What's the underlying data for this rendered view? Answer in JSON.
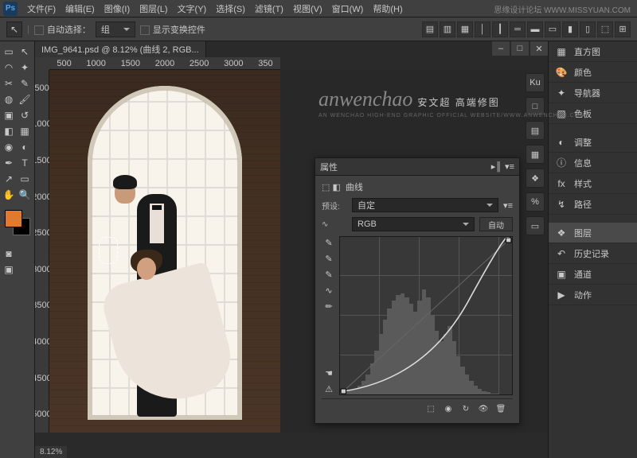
{
  "menubar": {
    "items": [
      "文件(F)",
      "编辑(E)",
      "图像(I)",
      "图层(L)",
      "文字(Y)",
      "选择(S)",
      "滤镜(T)",
      "视图(V)",
      "窗口(W)",
      "帮助(H)"
    ]
  },
  "watermark_top": "思缘设计论坛 WWW.MISSYUAN.COM",
  "options": {
    "auto_select": "自动选择：",
    "group": "组",
    "show_transform": "显示变换控件"
  },
  "document": {
    "tab_title": "IMG_9641.psd @ 8.12% (曲线 2, RGB...",
    "zoom": "8.12%",
    "ruler_h": [
      "500",
      "1000",
      "1500",
      "2000",
      "2500",
      "3000",
      "350"
    ],
    "ruler_v": [
      "500",
      "1000",
      "1500",
      "2000",
      "2500",
      "3000",
      "3500",
      "4000",
      "4500",
      "5000"
    ]
  },
  "center_wm": {
    "script": "anwenchao",
    "cn": "安文超 高端修图",
    "sub": "AN WENCHAO HIGH-END GRAPHIC OFFICIAL WEBSITE/WWW.ANWENCHAO.COM"
  },
  "props_panel": {
    "title": "属性",
    "curve_label": "曲线",
    "preset_label": "预设:",
    "preset_value": "自定",
    "channel_value": "RGB",
    "auto_btn": "自动"
  },
  "right_panels": [
    {
      "icon": "▦",
      "label": "直方图"
    },
    {
      "icon": "🎨",
      "label": "颜色"
    },
    {
      "icon": "✦",
      "label": "导航器"
    },
    {
      "icon": "▧",
      "label": "色板"
    },
    {
      "sep": true
    },
    {
      "icon": "◐",
      "label": "调整"
    },
    {
      "icon": "ⓘ",
      "label": "信息"
    },
    {
      "icon": "fx",
      "label": "样式"
    },
    {
      "icon": "↯",
      "label": "路径"
    },
    {
      "sep": true
    },
    {
      "icon": "❖",
      "label": "图层",
      "active": true
    },
    {
      "icon": "↶",
      "label": "历史记录"
    },
    {
      "icon": "▣",
      "label": "通道"
    },
    {
      "icon": "▶",
      "label": "动作"
    }
  ],
  "dock_icons": [
    "Ku",
    "□",
    "▤",
    "▦",
    "❖",
    "%",
    "▭"
  ]
}
